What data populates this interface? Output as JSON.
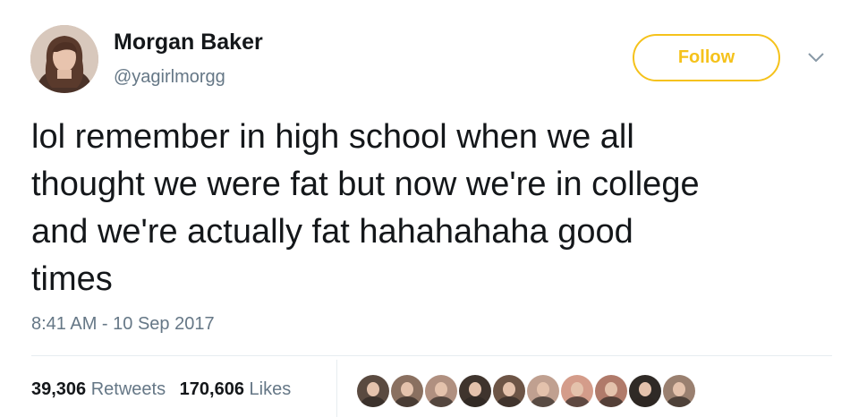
{
  "user": {
    "display_name": "Morgan Baker",
    "handle": "@yagirlmorgg",
    "avatar_icon": "profile-photo"
  },
  "actions": {
    "follow_label": "Follow",
    "more_icon": "chevron-down-icon",
    "accent_color": "#f5c21b"
  },
  "tweet": {
    "lines": [
      "lol remember in high school when we all",
      "thought we were fat but now we're in college",
      "and we're actually fat hahahahaha good",
      "times"
    ],
    "timestamp": "8:41 AM - 10 Sep 2017"
  },
  "stats": {
    "retweets_count": "39,306",
    "retweets_label": "Retweets",
    "likes_count": "170,606",
    "likes_label": "Likes"
  },
  "likers": {
    "count": 10,
    "colors": [
      "#5a4a40",
      "#8a7060",
      "#b09080",
      "#3f342d",
      "#6d5546",
      "#c0a090",
      "#d49c8a",
      "#b07a6a",
      "#2f2a26",
      "#9a8070"
    ]
  }
}
